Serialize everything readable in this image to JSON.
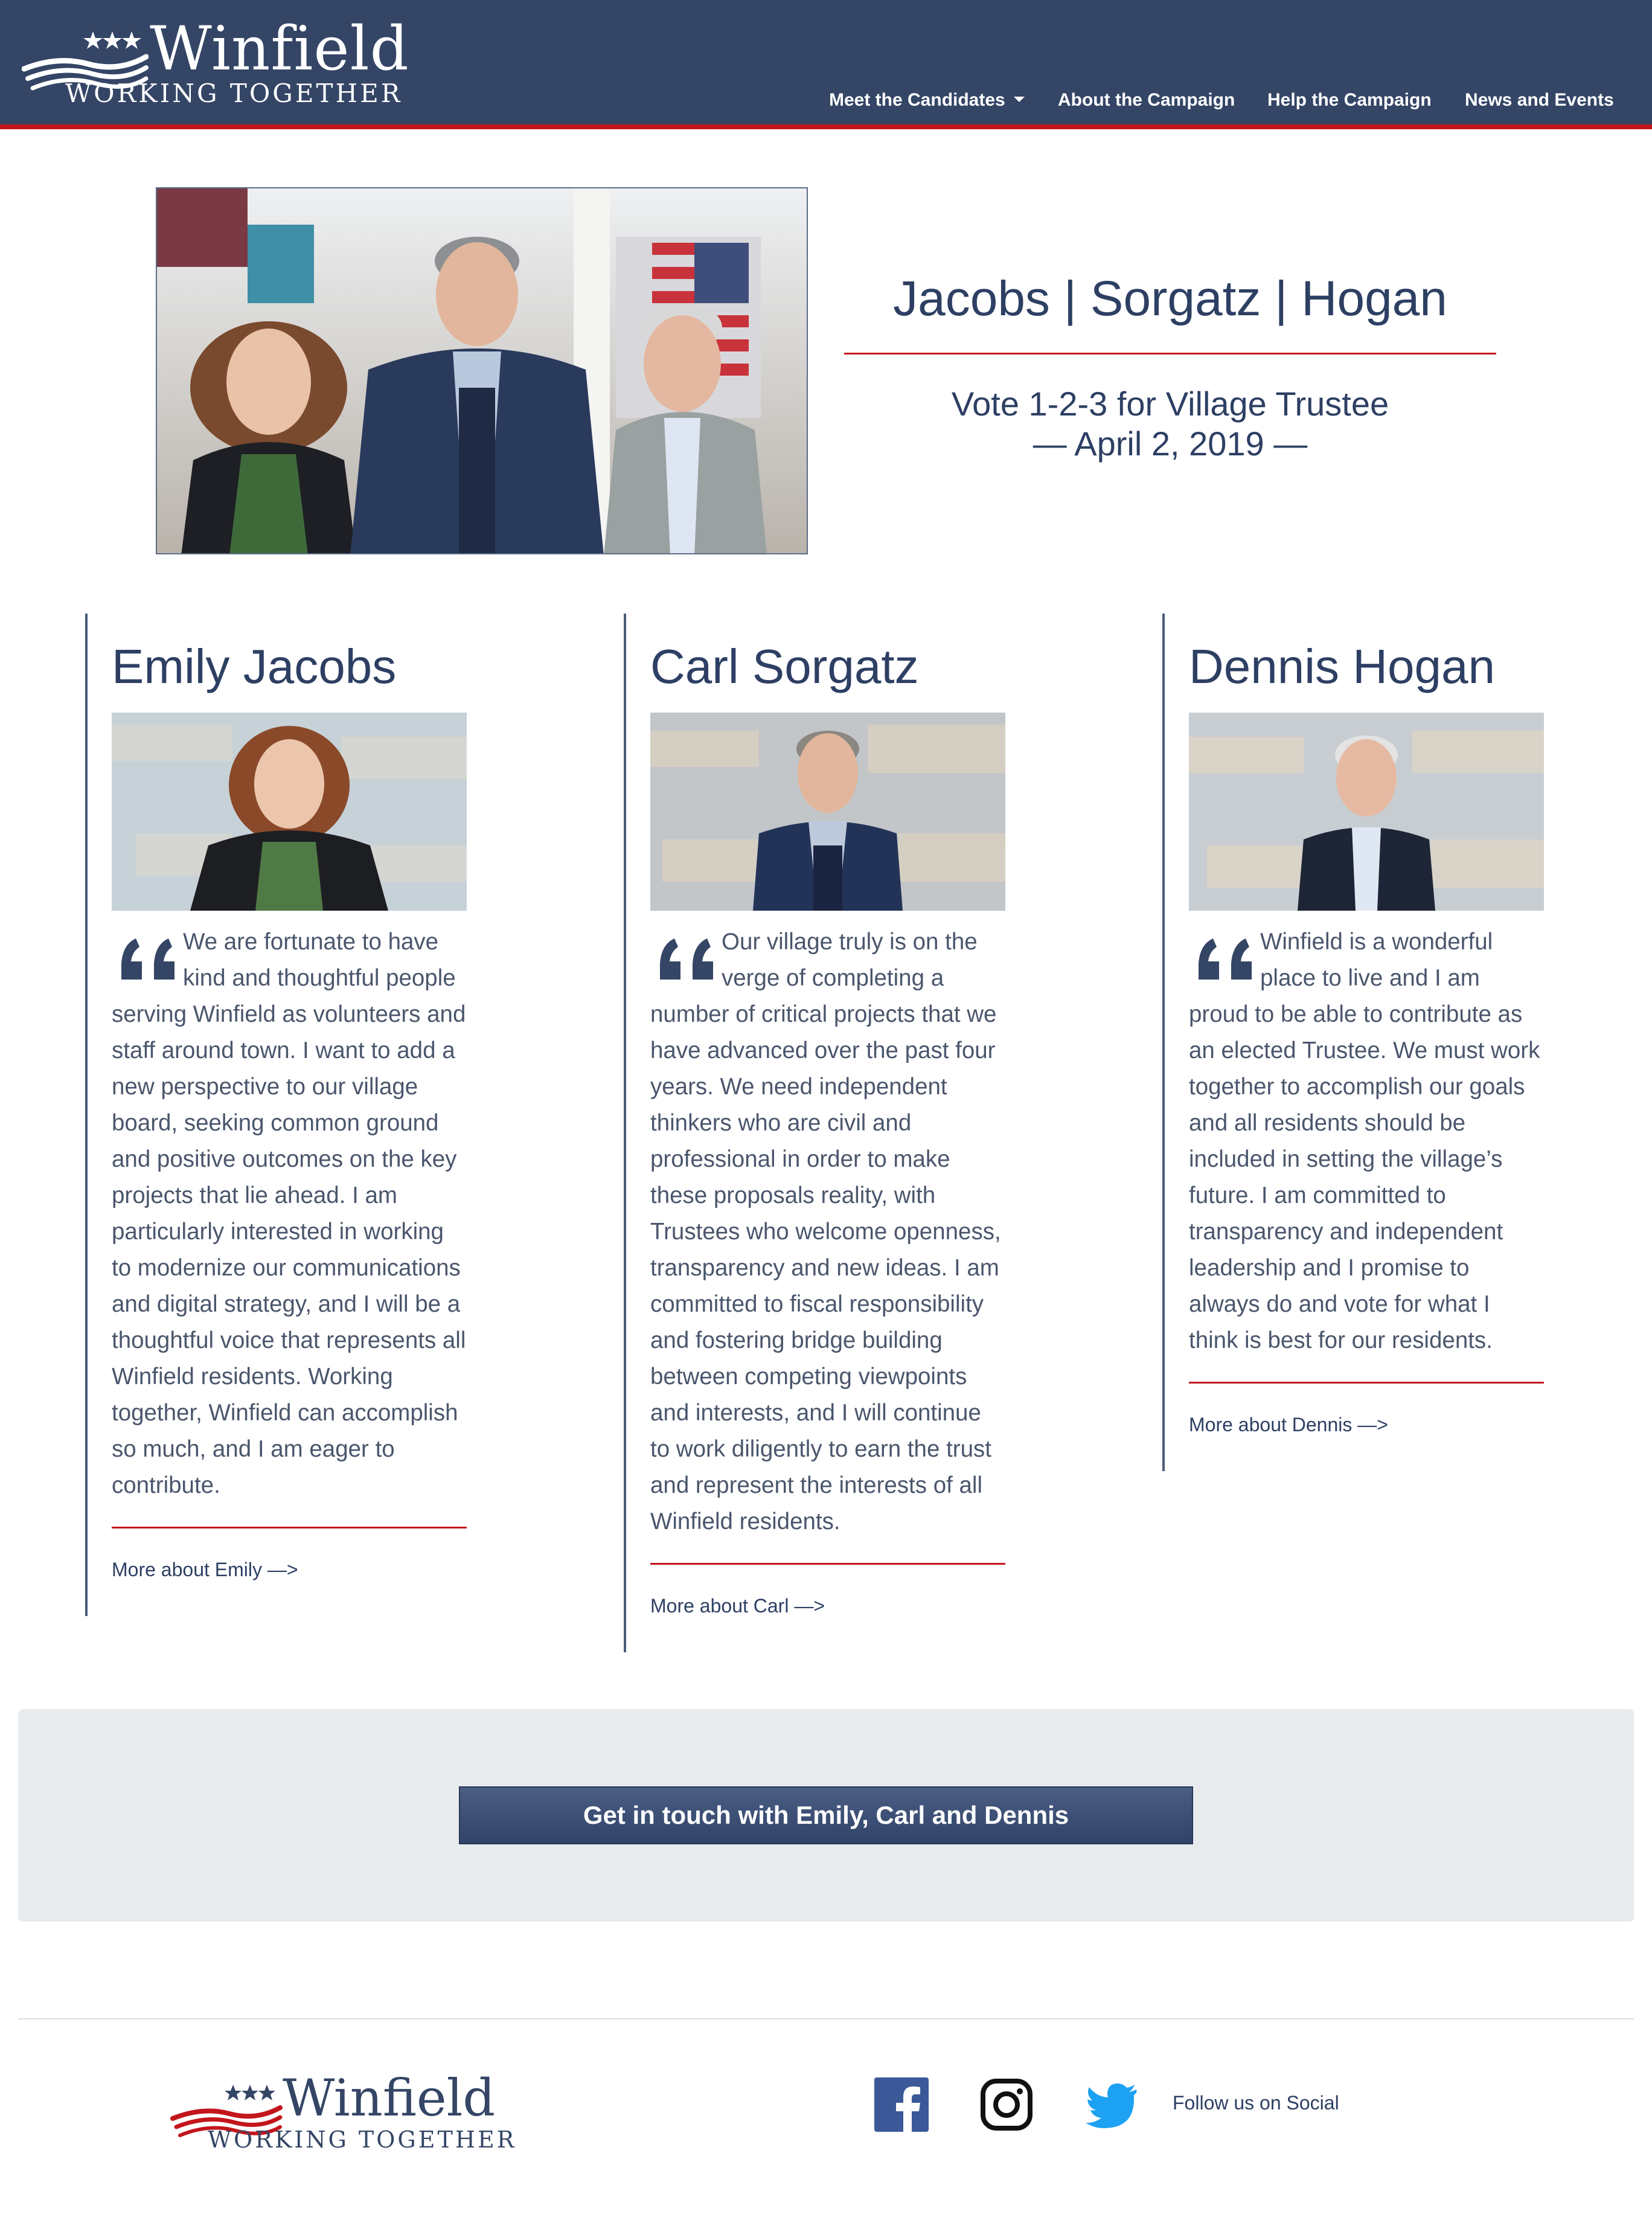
{
  "brand": {
    "name": "Winfield",
    "tagline": "WORKING TOGETHER"
  },
  "nav": {
    "items": [
      {
        "label": "Meet the Candidates",
        "has_dropdown": true
      },
      {
        "label": "About the Campaign"
      },
      {
        "label": "Help the Campaign"
      },
      {
        "label": "News and Events"
      }
    ]
  },
  "hero": {
    "title": "Jacobs | Sorgatz | Hogan",
    "subtitle_line1": "Vote 1-2-3 for Village Trustee",
    "subtitle_line2": "— April 2, 2019 —"
  },
  "candidates": [
    {
      "name": "Emily Jacobs",
      "quote": "We are fortunate to have kind and thoughtful people serving Winfield as volunteers and staff around town. I want to add a new perspective to our village board, seeking common ground and positive outcomes on the key projects that lie ahead. I am particularly interested in working to modernize our communications and digital strategy, and I will be a thoughtful voice that represents all Winfield residents. Working together, Winfield can accomplish so much, and I am eager to contribute.",
      "link": "More about Emily —>"
    },
    {
      "name": "Carl Sorgatz",
      "quote": "Our village truly is on the verge of completing a number of critical projects that we have advanced over the past four years. We need independent thinkers who are civil and professional in order to make these proposals reality, with Trustees who welcome openness, transparency and new ideas. I am committed to fiscal responsibility and fostering bridge building between competing viewpoints and interests, and I will continue to work diligently to earn the trust and represent the interests of all Winfield residents.",
      "link": "More about Carl —>"
    },
    {
      "name": "Dennis Hogan",
      "quote": "Winfield is a wonderful place to live and I am proud to be able to contribute as an elected Trustee. We must work together to accomplish our goals and all residents should be included in setting the village’s future. I am committed to transparency and independent leadership and I promise to always do and vote for what I think is best for our residents.",
      "link": "More about Dennis —>"
    }
  ],
  "cta": {
    "label": "Get in touch with Emily, Carl and Dennis"
  },
  "footer": {
    "follow_text": "Follow us on Social",
    "social_icons": [
      "facebook-icon",
      "instagram-icon",
      "twitter-icon"
    ]
  },
  "colors": {
    "navy": "#344566",
    "accent_red": "#c3161c",
    "text": "#2d3f63",
    "facebook": "#3b5998",
    "twitter": "#1da1f2"
  }
}
